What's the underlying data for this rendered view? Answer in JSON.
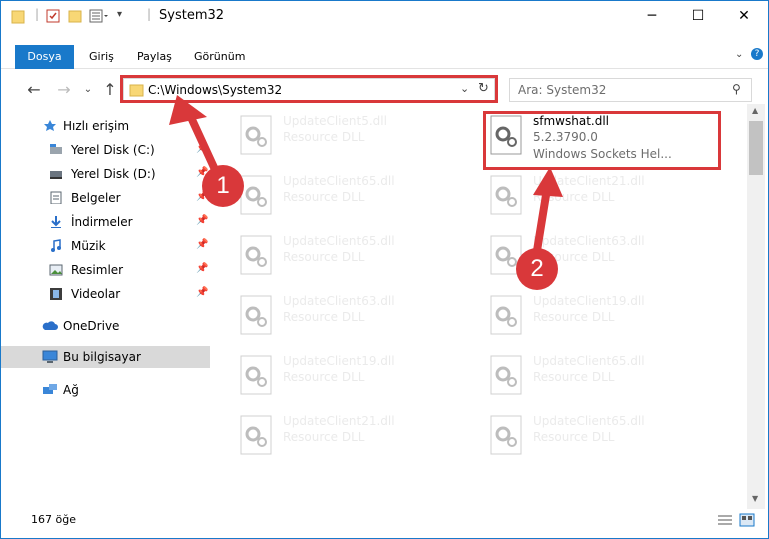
{
  "window": {
    "title": "System32",
    "min_icon": "minimize-icon",
    "max_icon": "maximize-icon",
    "close_icon": "close-icon"
  },
  "ribbon": {
    "tabs": [
      "Dosya",
      "Giriş",
      "Paylaş",
      "Görünüm"
    ]
  },
  "nav": {
    "address": "C:\\Windows\\System32",
    "search_placeholder": "Ara: System32"
  },
  "sidebar": {
    "items": [
      {
        "label": "Hızlı erişim",
        "icon": "star-icon"
      },
      {
        "label": "Yerel Disk (C:)",
        "icon": "drive-icon",
        "pinned": true
      },
      {
        "label": "Yerel Disk (D:)",
        "icon": "drive-icon",
        "pinned": true
      },
      {
        "label": "Belgeler",
        "icon": "documents-icon",
        "pinned": true
      },
      {
        "label": "İndirmeler",
        "icon": "download-icon",
        "pinned": true
      },
      {
        "label": "Müzik",
        "icon": "music-icon",
        "pinned": true
      },
      {
        "label": "Resimler",
        "icon": "pictures-icon",
        "pinned": true
      },
      {
        "label": "Videolar",
        "icon": "videos-icon",
        "pinned": true
      },
      {
        "label": "OneDrive",
        "icon": "cloud-icon"
      },
      {
        "label": "Bu bilgisayar",
        "icon": "computer-icon"
      },
      {
        "label": "Ağ",
        "icon": "network-icon"
      }
    ]
  },
  "files": [
    {
      "name": "UpdateClient5.dll",
      "type": "Resource DLL"
    },
    {
      "name": "sfmwshat.dll",
      "version": "5.2.3790.0",
      "desc": "Windows Sockets Hel..."
    },
    {
      "name": "UpdateClient65.dll",
      "type": "Resource DLL"
    },
    {
      "name": "UpdateClient21.dll",
      "type": "Resource DLL"
    },
    {
      "name": "UpdateClient65.dll",
      "type": "Resource DLL"
    },
    {
      "name": "UpdateClient63.dll",
      "type": "Resource DLL"
    },
    {
      "name": "UpdateClient63.dll",
      "type": "Resource DLL"
    },
    {
      "name": "UpdateClient19.dll",
      "type": "Resource DLL"
    },
    {
      "name": "UpdateClient19.dll",
      "type": "Resource DLL"
    },
    {
      "name": "UpdateClient65.dll",
      "type": "Resource DLL"
    },
    {
      "name": "UpdateClient21.dll",
      "type": "Resource DLL"
    },
    {
      "name": "UpdateClient65.dll",
      "type": "Resource DLL"
    }
  ],
  "status": {
    "count": "167 öğe"
  },
  "annotations": {
    "step1": "1",
    "step2": "2",
    "color": "#d9383a"
  }
}
